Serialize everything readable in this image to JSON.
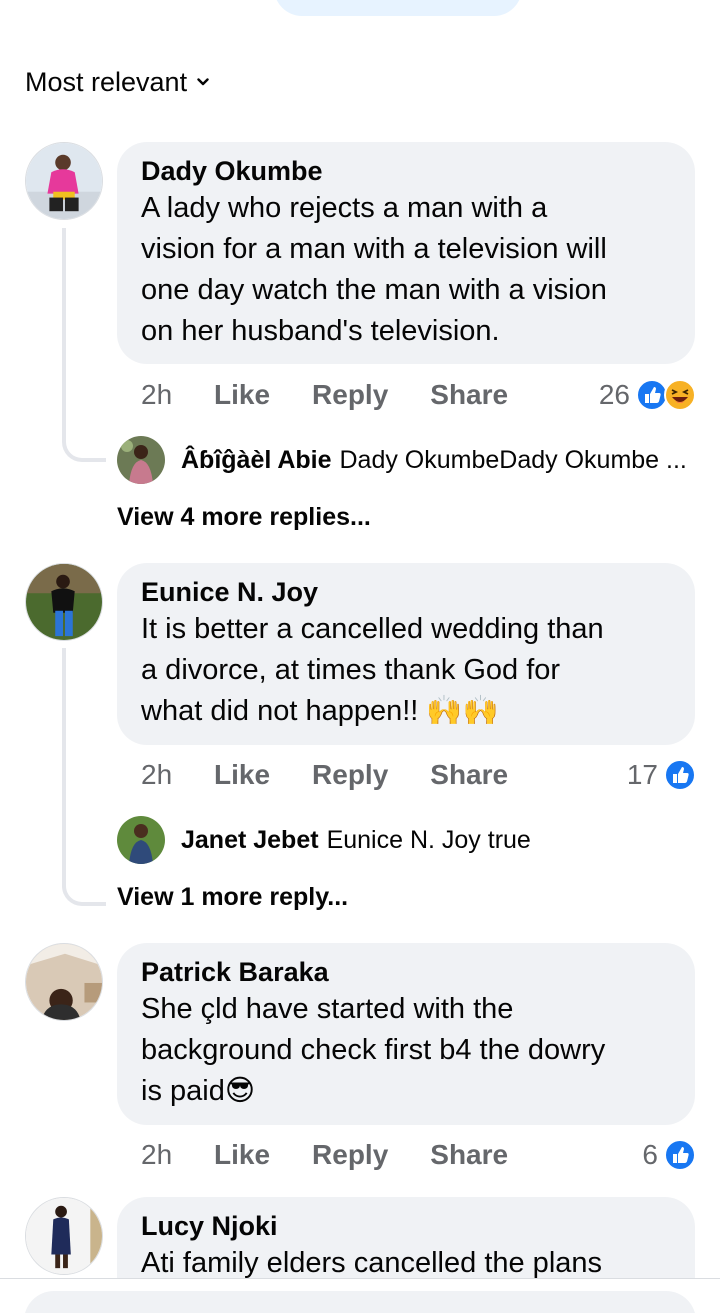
{
  "sort": {
    "label": "Most relevant",
    "icon": "chevron-down-icon"
  },
  "colors": {
    "like_blue": "#1877f2",
    "bubble": "#f0f2f5",
    "muted": "#65676b"
  },
  "comments": [
    {
      "author": "Dady Okumbe",
      "lines": [
        "A lady who rejects a man with a",
        "vision for a man with a television will",
        "one day watch the man with a vision",
        "on her husband's television."
      ],
      "time": "2h",
      "like": "Like",
      "reply": "Reply",
      "share": "Share",
      "reaction_count": "26",
      "reaction_icons": [
        "like-icon",
        "haha-icon"
      ],
      "reply_preview": {
        "author": "Âɓîĝàèl Abie",
        "text": "Dady OkumbeDady Okumbe ..."
      },
      "view_more": "View 4 more replies..."
    },
    {
      "author": "Eunice N. Joy",
      "lines": [
        "It is better a cancelled wedding than",
        "a divorce, at times thank God for",
        "what did not happen!! 🙌🙌"
      ],
      "time": "2h",
      "like": "Like",
      "reply": "Reply",
      "share": "Share",
      "reaction_count": "17",
      "reaction_icons": [
        "like-icon"
      ],
      "reply_preview": {
        "author": "Janet Jebet",
        "text": "Eunice N. Joy true"
      },
      "view_more": "View 1 more reply..."
    },
    {
      "author": "Patrick Baraka",
      "lines": [
        "She çld have started with the",
        "background check first b4 the dowry",
        "is paid😎"
      ],
      "time": "2h",
      "like": "Like",
      "reply": "Reply",
      "share": "Share",
      "reaction_count": "6",
      "reaction_icons": [
        "like-icon"
      ]
    },
    {
      "author": "Lucy Njoki",
      "lines": [
        "Ati family elders cancelled the plans"
      ]
    }
  ]
}
